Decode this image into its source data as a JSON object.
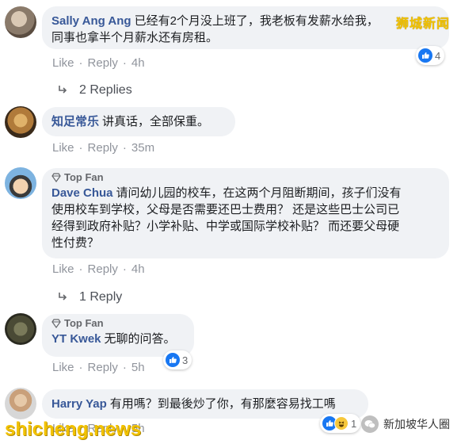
{
  "comments": [
    {
      "author": "Sally Ang Ang",
      "text": "已经有2个月没上班了，我老板有发薪水给我，的同事也拿半个月薪水还有房租。",
      "text_line1": "已经有2个月没上班了，我老板有发薪水给我，",
      "text_line2": "同事也拿半个月薪水还有房租。",
      "like": "Like",
      "reply": "Reply",
      "time": "4h",
      "reactions": "4",
      "replies": "2 Replies"
    },
    {
      "author": "知足常乐",
      "text": "讲真话，全部保重。",
      "like": "Like",
      "reply": "Reply",
      "time": "35m"
    },
    {
      "badge": "Top Fan",
      "author": "Dave Chua",
      "text_line1": "请问幼儿园的校车，在这两个月阻断期间，孩子们没有",
      "text_line2": "使用校车到学校，父母是否需要还巴士费用？ 还是这些巴士公司已",
      "text_line3": "经得到政府补贴？小学补贴、中学或国际学校补贴？ 而还要父母硬",
      "text_line4": "性付费？",
      "like": "Like",
      "reply": "Reply",
      "time": "4h",
      "replies": "1 Reply"
    },
    {
      "badge": "Top Fan",
      "author": "YT Kwek",
      "text": "无聊的问答。",
      "like": "Like",
      "reply": "Reply",
      "time": "5h",
      "reactions": "3"
    },
    {
      "author": "Harry Yap",
      "text": "有用嗎？到最後炒了你，有那麼容易找工嗎",
      "like": "Like",
      "reply": "Reply",
      "time": "5h",
      "reactions": "1"
    }
  ],
  "watermark_top": "狮城新闻",
  "watermark_bottom": "shicheng.news",
  "wechat_label": "新加坡华人圈",
  "colors": {
    "name": "#385898",
    "bubble": "#f0f2f5",
    "like": "#1877f2",
    "watermark": "#f2c200"
  }
}
